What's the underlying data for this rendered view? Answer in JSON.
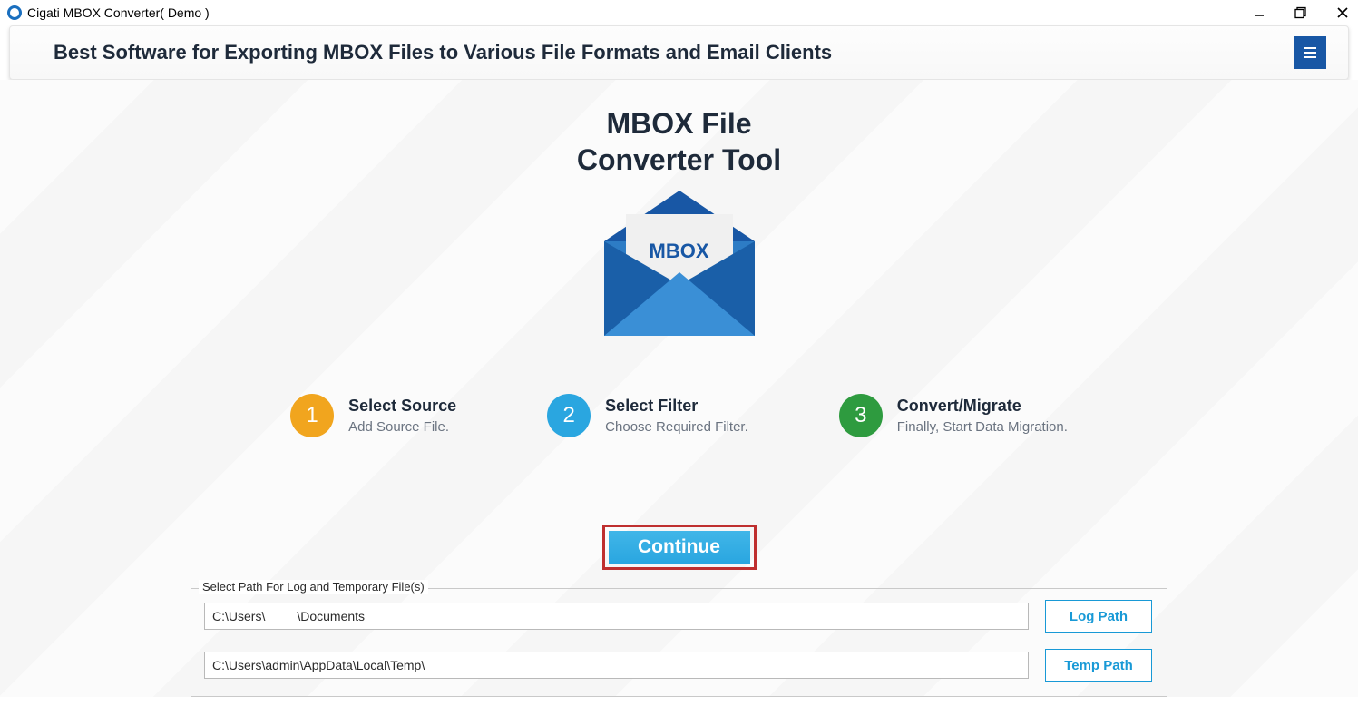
{
  "titlebar": {
    "title": "Cigati MBOX Converter( Demo )"
  },
  "header": {
    "title": "Best Software for Exporting MBOX Files to Various File Formats and Email Clients"
  },
  "hero": {
    "line1": "MBOX File",
    "line2": "Converter Tool",
    "envelope_label": "MBOX"
  },
  "steps": [
    {
      "num": "1",
      "title": "Select Source",
      "sub": "Add Source File.",
      "color": "#f1a51e"
    },
    {
      "num": "2",
      "title": "Select Filter",
      "sub": "Choose Required Filter.",
      "color": "#2aa6e0"
    },
    {
      "num": "3",
      "title": "Convert/Migrate",
      "sub": "Finally, Start Data Migration.",
      "color": "#2e9b3f"
    }
  ],
  "continue_label": "Continue",
  "paths": {
    "legend": "Select Path For Log and Temporary File(s)",
    "log_value": "C:\\Users\\         \\Documents",
    "temp_value": "C:\\Users\\admin\\AppData\\Local\\Temp\\",
    "log_btn": "Log Path",
    "temp_btn": "Temp Path"
  }
}
